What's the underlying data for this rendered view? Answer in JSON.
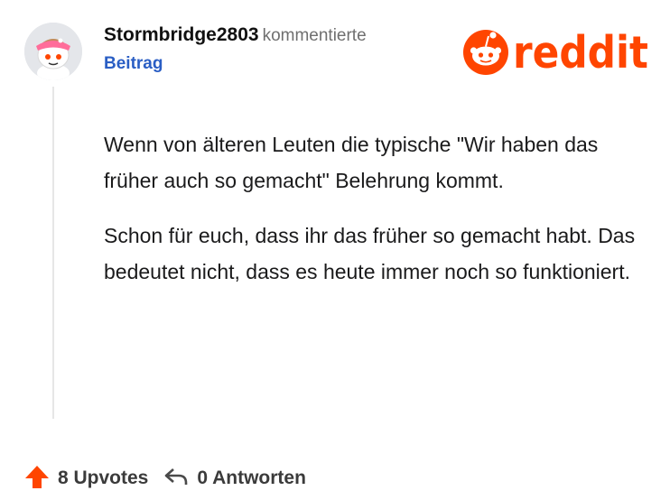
{
  "comment": {
    "username": "Stormbridge2803",
    "action": "kommentierte",
    "post_link": "Beitrag",
    "paragraphs": [
      "Wenn von älteren Leuten die typische \"Wir haben das früher auch so gemacht\" Belehrung kommt.",
      "Schon für euch, dass ihr das früher so gemacht habt. Das bedeutet nicht, dass es heute immer noch so funktioniert."
    ]
  },
  "footer": {
    "upvotes": "8 Upvotes",
    "replies": "0 Antworten"
  },
  "brand": {
    "logo_text": "reddit",
    "color": "#ff4500"
  },
  "icons": {
    "upvote": "upvote-arrow-icon",
    "reply": "reply-arrow-icon"
  }
}
